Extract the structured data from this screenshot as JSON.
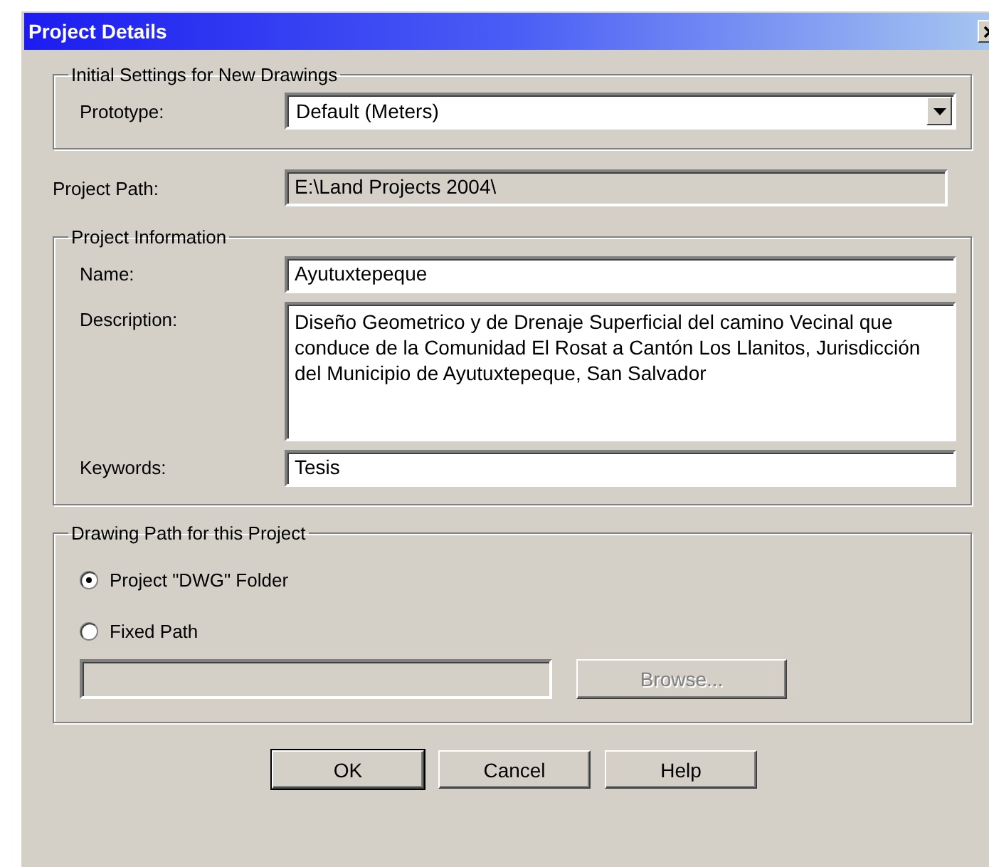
{
  "window": {
    "title": "Project Details"
  },
  "initial_settings": {
    "legend": "Initial Settings for New Drawings",
    "prototype": {
      "label": "Prototype:",
      "value": "Default (Meters)"
    }
  },
  "project_path": {
    "label": "Project Path:",
    "value": "E:\\Land Projects 2004\\",
    "disabled": true
  },
  "project_information": {
    "legend": "Project Information",
    "fields": [
      {
        "label": "Name:",
        "value": "Ayutuxtepeque",
        "kind": "line"
      },
      {
        "label": "Description:",
        "value": "Diseño Geometrico y de Drenaje Superficial del camino Vecinal que conduce de la Comunidad El Rosat a Cantón Los Llanitos, Jurisdicción del Municipio de Ayutuxtepeque, San Salvador",
        "kind": "area"
      },
      {
        "label": "Keywords:",
        "value": "Tesis",
        "kind": "line"
      }
    ]
  },
  "drawing_path": {
    "legend": "Drawing Path for this Project",
    "options": [
      {
        "label": "Project \"DWG\" Folder",
        "selected": true
      },
      {
        "label": "Fixed Path",
        "selected": false
      }
    ],
    "path_field": {
      "disabled": true
    },
    "browse": {
      "label": "Browse...",
      "disabled": true
    }
  },
  "buttons": [
    {
      "label": "OK",
      "default": true
    },
    {
      "label": "Cancel",
      "default": false
    },
    {
      "label": "Help",
      "default": false
    }
  ]
}
